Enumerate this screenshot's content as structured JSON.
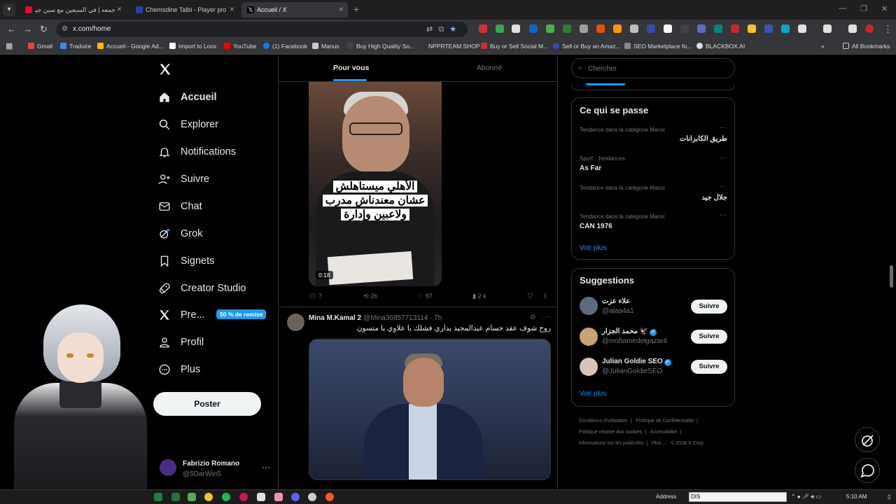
{
  "browser": {
    "tabs": [
      {
        "label": "جمعه | في السبعين مع سين جيم",
        "color": "#ff0033",
        "active": false
      },
      {
        "label": "Chemsdine Talbi - Player profile",
        "color": "#2c3e9e",
        "active": false
      },
      {
        "label": "Accueil / X",
        "color": "#000000",
        "active": true
      }
    ],
    "url": "x.com/home",
    "bookmarks": [
      {
        "label": "Gmail",
        "color": "#ea4335"
      },
      {
        "label": "Traduire",
        "color": "#4285f4"
      },
      {
        "label": "Accueil - Google Ad...",
        "color": "#fbbc04"
      },
      {
        "label": "Import to Loox",
        "color": "#ffffff"
      },
      {
        "label": "YouTube",
        "color": "#ff0000"
      },
      {
        "label": "(1) Facebook",
        "color": "#1877f2"
      },
      {
        "label": "Manus",
        "color": "#cccccc"
      },
      {
        "label": "Buy High Quality So...",
        "color": "#444444"
      },
      {
        "label": "NPPRTEAM.SHOP",
        "color": "#35363a"
      },
      {
        "label": "Buy or Sell Social M...",
        "color": "#d32f2f"
      },
      {
        "label": "Sell or Buy an Amaz...",
        "color": "#3949ab"
      },
      {
        "label": "SEO Marketplace fo...",
        "color": "#888888"
      },
      {
        "label": "BLACKBOX.AI",
        "color": "#dddddd"
      }
    ],
    "all_bookmarks": "All Bookmarks"
  },
  "nav": {
    "logo": "X",
    "items": [
      {
        "label": "Accueil",
        "icon": "home-icon"
      },
      {
        "label": "Explorer",
        "icon": "search-icon"
      },
      {
        "label": "Notifications",
        "icon": "bell-icon"
      },
      {
        "label": "Suivre",
        "icon": "person-plus-icon"
      },
      {
        "label": "Chat",
        "icon": "mail-icon"
      },
      {
        "label": "Grok",
        "icon": "grok-icon"
      },
      {
        "label": "Signets",
        "icon": "bookmark-icon"
      },
      {
        "label": "Creator Studio",
        "icon": "rocket-icon"
      },
      {
        "label": "Pre...",
        "icon": "x-icon"
      },
      {
        "label": "Profil",
        "icon": "person-icon"
      },
      {
        "label": "Plus",
        "icon": "more-circle-icon"
      }
    ],
    "premium_badge": "50 % de remise",
    "post_button": "Poster",
    "account": {
      "name": "Fabrizio Romano",
      "handle": "@5DarWin5"
    }
  },
  "timeline": {
    "tabs": [
      "Pour vous",
      "Abonné"
    ],
    "tweet1": {
      "caption_lines": [
        "الأهلي ميستاهلش",
        "عشان معندناش مدرب",
        "ولاعبين وإدارة"
      ],
      "duration": "0:18",
      "replies": "7",
      "reposts": "26",
      "likes": "97",
      "views": "2 k"
    },
    "tweet2": {
      "name": "Mina M.Kamal 2",
      "handle": "@Mina36857713114 · 7h",
      "text": "روح شوف عقد حسام عبدالمجيد يداري فشلك يا علاوي يا متسون"
    }
  },
  "sidebar": {
    "search_placeholder": "Chercher",
    "trends_title": "Ce qui se passe",
    "trends": [
      {
        "meta": "Tendance dans la catégorie Maroc",
        "name": "طريق الكابرانات",
        "rtl": true
      },
      {
        "meta": "Sport · Tendances",
        "name": "As Far",
        "rtl": false
      },
      {
        "meta": "Tendance dans la catégorie Maroc",
        "name": "جلال جيد",
        "rtl": true
      },
      {
        "meta": "Tendance dans la catégorie Maroc",
        "name": "CAN 1976",
        "rtl": false
      }
    ],
    "see_more": "Voir plus",
    "suggestions_title": "Suggestions",
    "suggestions": [
      {
        "name": "علاء عزت",
        "handle": "@alaa4a1",
        "verified": false,
        "avatar_color": "#5b6b80"
      },
      {
        "name": "محمد الجزار 🦅",
        "handle": "@mohamedelgazar4",
        "verified": true,
        "avatar_color": "#c9a27a"
      },
      {
        "name": "Julian Goldie SEO",
        "handle": "@JulianGoldieSEO",
        "verified": true,
        "avatar_color": "#d8c4b8"
      }
    ],
    "follow_label": "Suivre",
    "footer": [
      "Conditions d'utilisation",
      "|",
      "Politique de Confidentialité",
      "|",
      "Politique relative aux cookies",
      "|",
      "Accessibilité",
      "|",
      "Informations sur les publicités",
      "|",
      "Plus ...",
      "© 2026 X Corp."
    ]
  },
  "taskbar": {
    "address_label": "Address",
    "address_value": "DIS",
    "time": "5:10 AM"
  }
}
